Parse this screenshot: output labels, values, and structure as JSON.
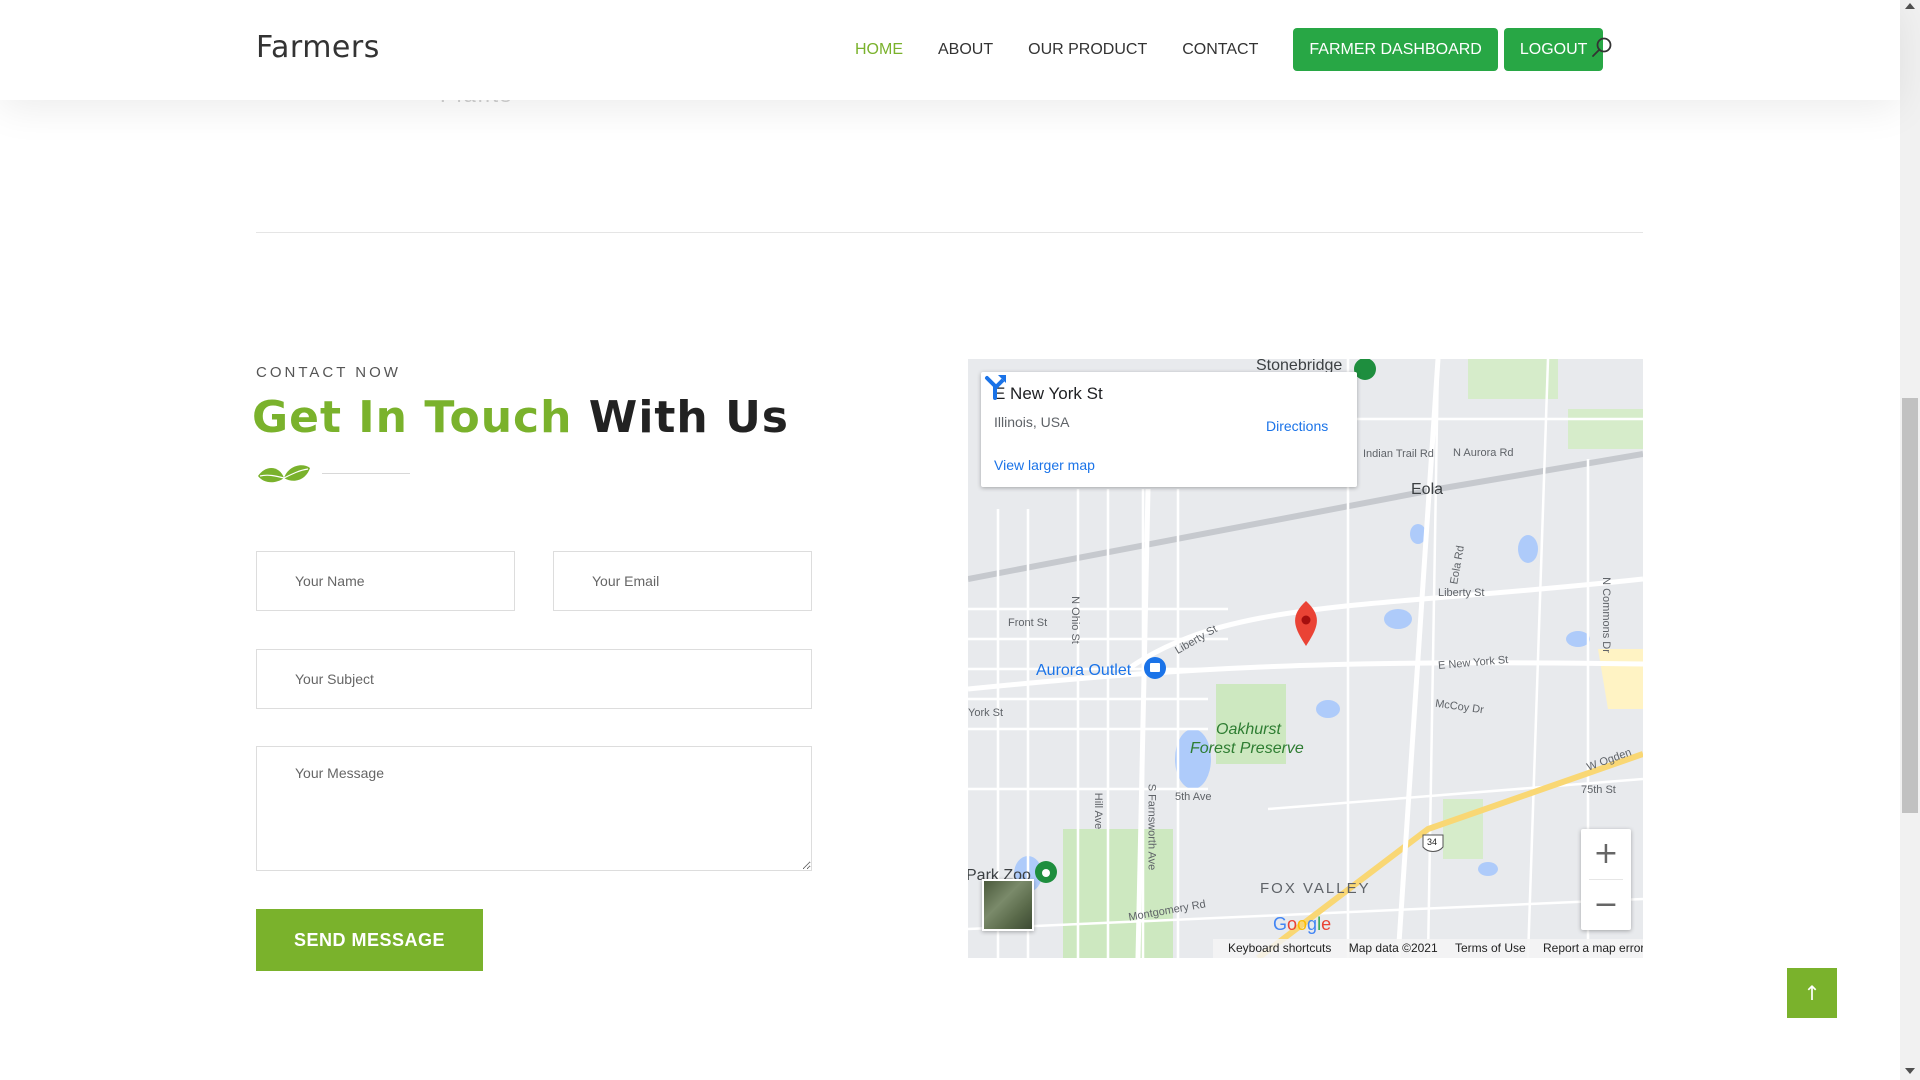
{
  "brand": "Farmers",
  "nav": {
    "home": "HOME",
    "about": "ABOUT",
    "product": "OUR PRODUCT",
    "contact": "CONTACT",
    "dashboard": "FARMER DASHBOARD",
    "logout": "LOGOUT",
    "active_color": "#7ab22c",
    "button_color": "#28a745"
  },
  "ghost_text": "Plants",
  "contact": {
    "eyebrow": "CONTACT NOW",
    "heading_green": "Get In Touch",
    "heading_dark": "With Us",
    "name_placeholder": "Your Name",
    "email_placeholder": "Your Email",
    "subject_placeholder": "Your Subject",
    "message_placeholder": "Your Message",
    "send_label": "SEND MESSAGE",
    "accent_color": "#7ab22c"
  },
  "map": {
    "place_title": "E New York St",
    "place_region": "Illinois, USA",
    "directions_label": "Directions",
    "larger_map_label": "View larger map",
    "labels": {
      "stonebridge": "Stonebridge",
      "eola": "Eola",
      "indian_trail": "Indian Trail Rd",
      "n_aurora": "N Aurora Rd",
      "eola_rd": "Eola Rd",
      "liberty_st": "Liberty St",
      "liberty_st2": "Liberty St",
      "front_st": "Front St",
      "n_ohio": "N Ohio St",
      "aurora_outlet": "Aurora Outlet",
      "e_new_york": "E New York St",
      "mccoy": "McCoy Dr",
      "oakhurst": "Oakhurst",
      "forest_preserve": "Forest Preserve",
      "fifth_ave": "5th Ave",
      "w_ogden": "W Ogden",
      "seventyfifth": "75th St",
      "park_zoo": "Park Zoo",
      "fox_valley": "FOX VALLEY",
      "montgomery": "Montgomery Rd",
      "hill_ave": "Hill Ave",
      "s_farnsworth": "S Farnsworth Ave",
      "n_commons": "N Commons Dr",
      "york_st": "York St",
      "route_34": "34"
    },
    "zoom_in": "+",
    "zoom_out": "−",
    "google": "Google",
    "attribution": {
      "shortcuts": "Keyboard shortcuts",
      "data": "Map data ©2021",
      "terms": "Terms of Use",
      "report": "Report a map error"
    }
  },
  "back_to_top": "↑"
}
